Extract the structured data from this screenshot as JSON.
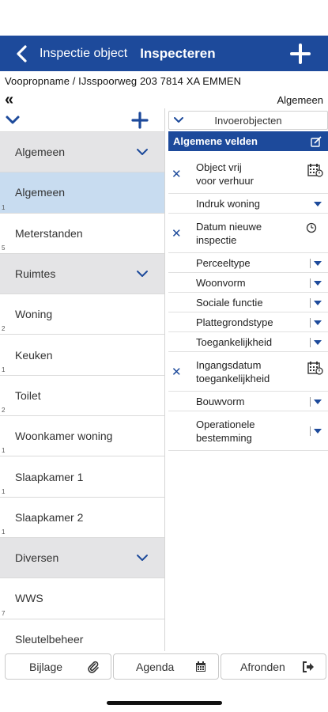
{
  "nav": {
    "back_label": "Inspectie object",
    "title": "Inspecteren"
  },
  "address": "Voopropname / IJsspoorweg 203  7814 XA EMMEN",
  "section_label": "Algemeen",
  "left_list": [
    {
      "label": "Algemeen",
      "kind": "group",
      "count": ""
    },
    {
      "label": "Algemeen",
      "kind": "selected",
      "count": "1"
    },
    {
      "label": "Meterstanden",
      "kind": "item",
      "count": "5"
    },
    {
      "label": "Ruimtes",
      "kind": "group",
      "count": ""
    },
    {
      "label": "Woning",
      "kind": "item",
      "count": "2"
    },
    {
      "label": "Keuken",
      "kind": "item",
      "count": "1"
    },
    {
      "label": "Toilet",
      "kind": "item",
      "count": "2"
    },
    {
      "label": "Woonkamer woning",
      "kind": "item",
      "count": "1"
    },
    {
      "label": "Slaapkamer 1",
      "kind": "item",
      "count": "1"
    },
    {
      "label": "Slaapkamer 2",
      "kind": "item",
      "count": "1"
    },
    {
      "label": "Diversen",
      "kind": "group",
      "count": ""
    },
    {
      "label": "WWS",
      "kind": "item",
      "count": "7"
    },
    {
      "label": "Sleutelbeheer",
      "kind": "item",
      "count": ""
    }
  ],
  "right": {
    "invoer_label": "Invoerobjecten",
    "header": "Algemene velden",
    "fields": [
      {
        "label": "Object vrij\nvoor verhuur",
        "control": "calendar",
        "clear": true
      },
      {
        "label": "Indruk woning",
        "control": "dropdown",
        "clear": false
      },
      {
        "label": "Datum nieuwe\ninspectie",
        "control": "clock",
        "clear": true
      },
      {
        "label": "Perceeltype",
        "control": "dropdown-bar",
        "clear": false
      },
      {
        "label": "Woonvorm",
        "control": "dropdown-bar",
        "clear": false
      },
      {
        "label": "Sociale functie",
        "control": "dropdown-bar",
        "clear": false
      },
      {
        "label": "Plattegrondstype",
        "control": "dropdown-bar",
        "clear": false
      },
      {
        "label": "Toegankelijkheid",
        "control": "dropdown-bar",
        "clear": false
      },
      {
        "label": "Ingangsdatum\ntoegankelijkheid",
        "control": "calendar",
        "clear": true
      },
      {
        "label": "Bouwvorm",
        "control": "dropdown-bar",
        "clear": false
      },
      {
        "label": "Operationele\nbestemming",
        "control": "dropdown-bar",
        "clear": false
      }
    ]
  },
  "bottom": {
    "bijlage": "Bijlage",
    "agenda": "Agenda",
    "afronden": "Afronden"
  },
  "colors": {
    "primary": "#1d4a9b",
    "selected_row": "#c8dcf0",
    "group_row": "#e4e4e6"
  }
}
